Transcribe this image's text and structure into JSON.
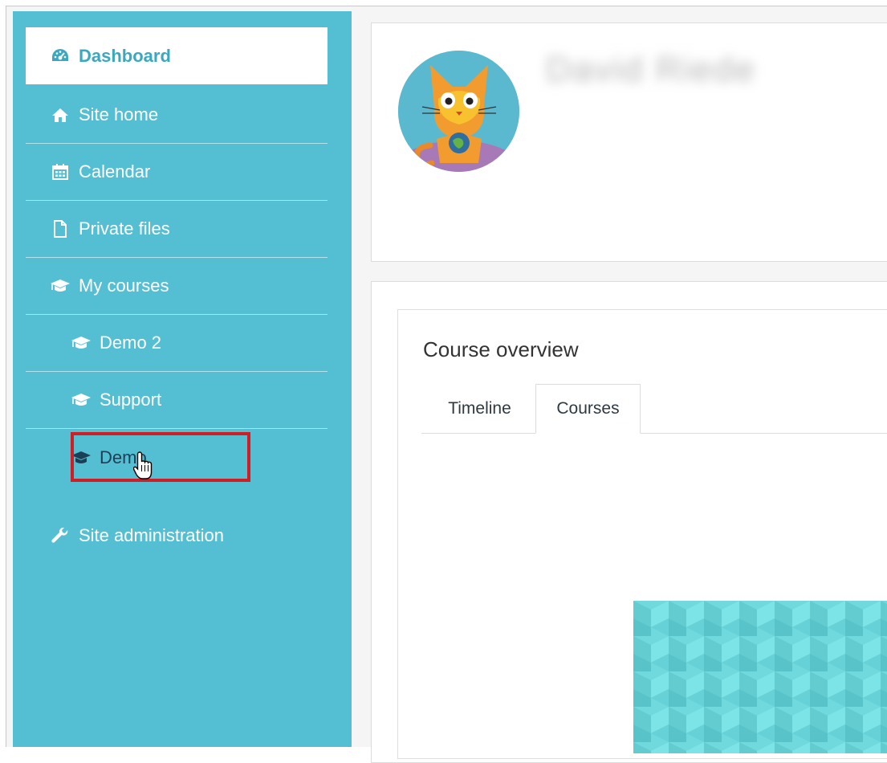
{
  "nav": {
    "dashboard": "Dashboard",
    "site_home": "Site home",
    "calendar": "Calendar",
    "private_files": "Private files",
    "my_courses": "My courses",
    "courses": [
      "Demo 2",
      "Support",
      "Demo"
    ],
    "site_admin": "Site administration"
  },
  "profile": {
    "name": "David Riede"
  },
  "overview": {
    "title": "Course overview",
    "tabs": [
      "Timeline",
      "Courses"
    ],
    "active_tab": "Courses"
  },
  "colors": {
    "sidebar": "#54bfd3",
    "active_text": "#3aa9bf",
    "highlight": "#d11e25",
    "course_image": "#6fd9dd"
  }
}
